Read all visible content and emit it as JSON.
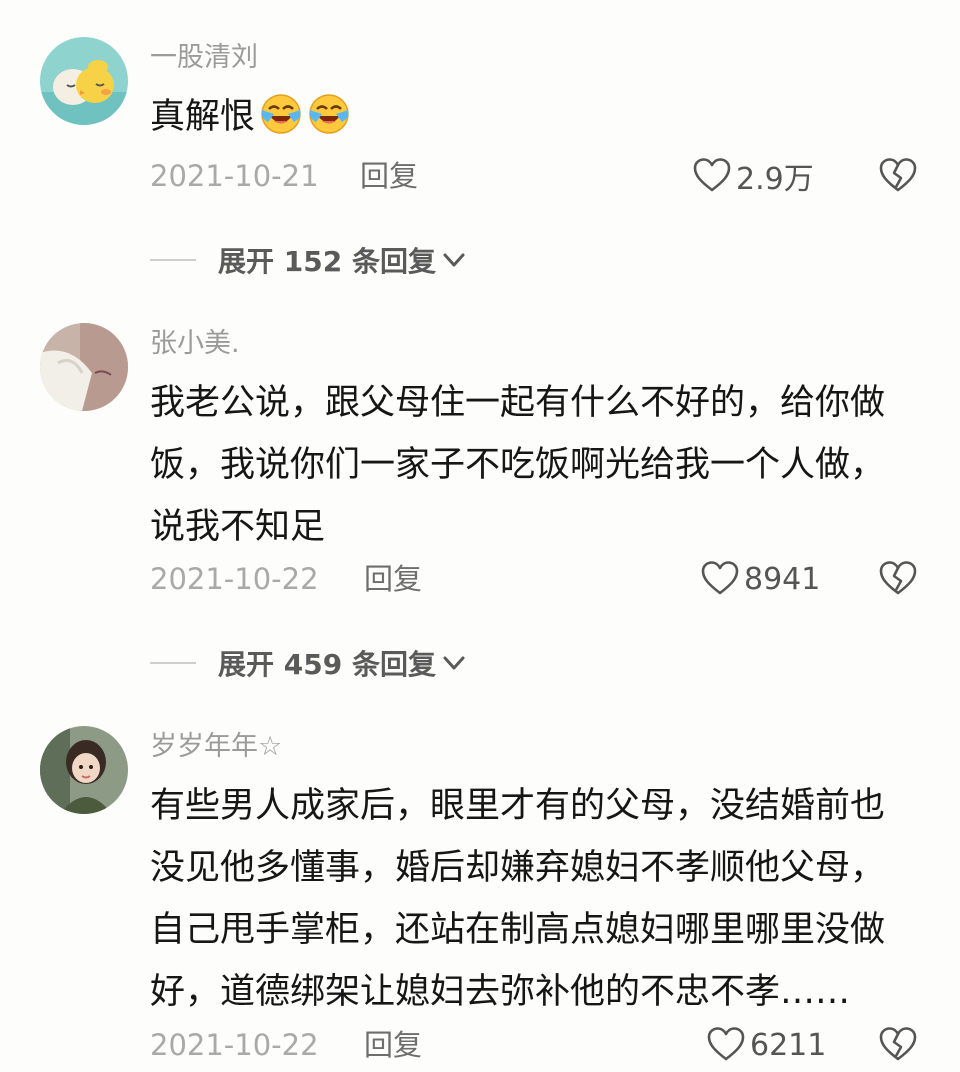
{
  "comments": [
    {
      "username": "一股清刘",
      "lines": [
        "真解恨"
      ],
      "emojis": [
        "cry-laugh-emoji",
        "cry-laugh-emoji"
      ],
      "date": "2021-10-21",
      "reply_label": "回复",
      "likes": "2.9万",
      "expand_label": "展开 152 条回复",
      "avatar_icon": "chick-avatar"
    },
    {
      "username": "张小美.",
      "lines": [
        "我老公说，跟父母住一起有什么不好的，给你做",
        "饭，我说你们一家子不吃饭啊光给我一个人做，",
        "说我不知足"
      ],
      "date": "2021-10-22",
      "reply_label": "回复",
      "likes": "8941",
      "expand_label": "展开 459 条回复",
      "avatar_icon": "photo-avatar"
    },
    {
      "username": "岁岁年年☆",
      "lines": [
        "有些男人成家后，眼里才有的父母，没结婚前也",
        "没见他多懂事，婚后却嫌弃媳妇不孝顺他父母，",
        "自己甩手掌柜，还站在制高点媳妇哪里哪里没做",
        "好，道德绑架让媳妇去弥补他的不忠不孝……"
      ],
      "date": "2021-10-22",
      "reply_label": "回复",
      "likes": "6211",
      "avatar_icon": "child-photo-avatar"
    }
  ],
  "colors": {
    "background": "#fdfdfb",
    "text": "#161616",
    "muted": "#9b9b9b"
  }
}
